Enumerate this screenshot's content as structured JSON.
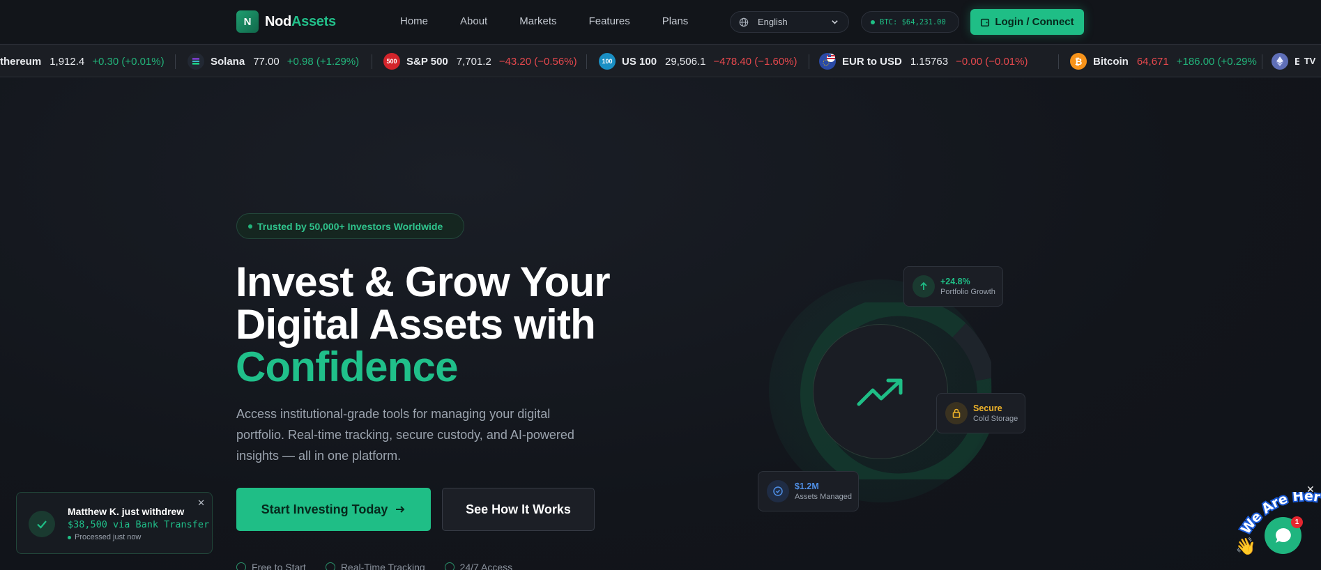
{
  "nav": {
    "logo_mark": "N",
    "logo_part1": "Nod",
    "logo_part2": "Assets",
    "links": [
      "Home",
      "About",
      "Markets",
      "Features",
      "Plans"
    ],
    "language": "English",
    "btc_price": "BTC: $64,231.00",
    "login_label": "Login / Connect"
  },
  "ticker": {
    "items": [
      {
        "name": "thereum",
        "price": "1,912.4",
        "change": "+0.30 (+0.01%)",
        "dir": "up",
        "icon": "",
        "icon_color": ""
      },
      {
        "name": "Solana",
        "price": "77.00",
        "change": "+0.98 (+1.29%)",
        "dir": "up",
        "icon": "",
        "icon_color": "#222833"
      },
      {
        "name": "S&P 500",
        "price": "7,701.2",
        "change": "−43.20 (−0.56%)",
        "dir": "down",
        "icon": "500",
        "icon_color": "#d3242b"
      },
      {
        "name": "US 100",
        "price": "29,506.1",
        "change": "−478.40 (−1.60%)",
        "dir": "down",
        "icon": "100",
        "icon_color": "#1a8fc4"
      },
      {
        "name": "EUR to USD",
        "price": "1.15763",
        "change": "−0.00 (−0.01%)",
        "dir": "down",
        "icon": "",
        "icon_color": "#2a4aa6"
      },
      {
        "name": "Bitcoin",
        "price": "64,671",
        "change": "+186.00 (+0.29%",
        "dir": "up",
        "icon": "₿",
        "icon_color": "#f7931a"
      },
      {
        "name": "E",
        "price": "",
        "change": "",
        "dir": "up",
        "icon": "",
        "icon_color": "#5f6fb8"
      }
    ],
    "tv_logo": "TV"
  },
  "hero": {
    "trust_badge": "Trusted by 50,000+ Investors Worldwide",
    "title_line1": "Invest & Grow Your",
    "title_line2": "Digital Assets with",
    "title_highlight": "Confidence",
    "subtitle": "Access institutional-grade tools for managing your digital portfolio. Real-time tracking, secure custody, and AI-powered insights — all in one platform.",
    "cta_primary": "Start Investing Today",
    "cta_secondary": "See How It Works",
    "features": [
      "Free to Start",
      "Real-Time Tracking",
      "24/7 Access"
    ]
  },
  "visual": {
    "growth_value": "+24.8%",
    "growth_label": "Portfolio Growth",
    "secure_value": "Secure",
    "secure_label": "Cold Storage",
    "assets_value": "$1.2M",
    "assets_label": "Assets Managed"
  },
  "toast": {
    "title": "Matthew K. just withdrew",
    "amount": "$38,500 via Bank Transfer",
    "status": "Processed just now"
  },
  "chat": {
    "banner": "We Are Here!",
    "badge": "1"
  },
  "colors": {
    "accent": "#1fbe86",
    "up": "#22b37a",
    "down": "#e5484d",
    "secure": "#f0b429",
    "assets": "#4f8fe6"
  }
}
